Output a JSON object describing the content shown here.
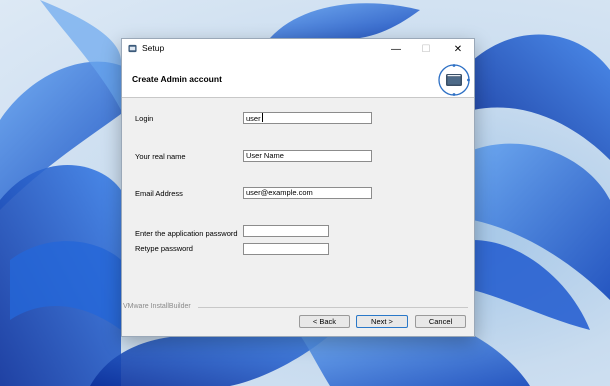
{
  "window": {
    "title": "Setup",
    "minimize_glyph": "—",
    "maximize_glyph": "☐",
    "close_glyph": "✕"
  },
  "header": {
    "title": "Create Admin account",
    "logo_icon": "installer-window-icon"
  },
  "form": {
    "login": {
      "label": "Login",
      "value": "user"
    },
    "real_name": {
      "label": "Your real name",
      "value": "User Name"
    },
    "email": {
      "label": "Email Address",
      "value": "user@example.com"
    },
    "password": {
      "label": "Enter the application password",
      "value": ""
    },
    "retype": {
      "label": "Retype password",
      "value": ""
    }
  },
  "footer": {
    "brand": "VMware InstallBuilder",
    "back_label": "< Back",
    "next_label": "Next >",
    "cancel_label": "Cancel"
  },
  "colors": {
    "dialog_bg": "#f0f0f0",
    "accent": "#2a78c8",
    "wallpaper_blue": "#1a5fd6"
  }
}
